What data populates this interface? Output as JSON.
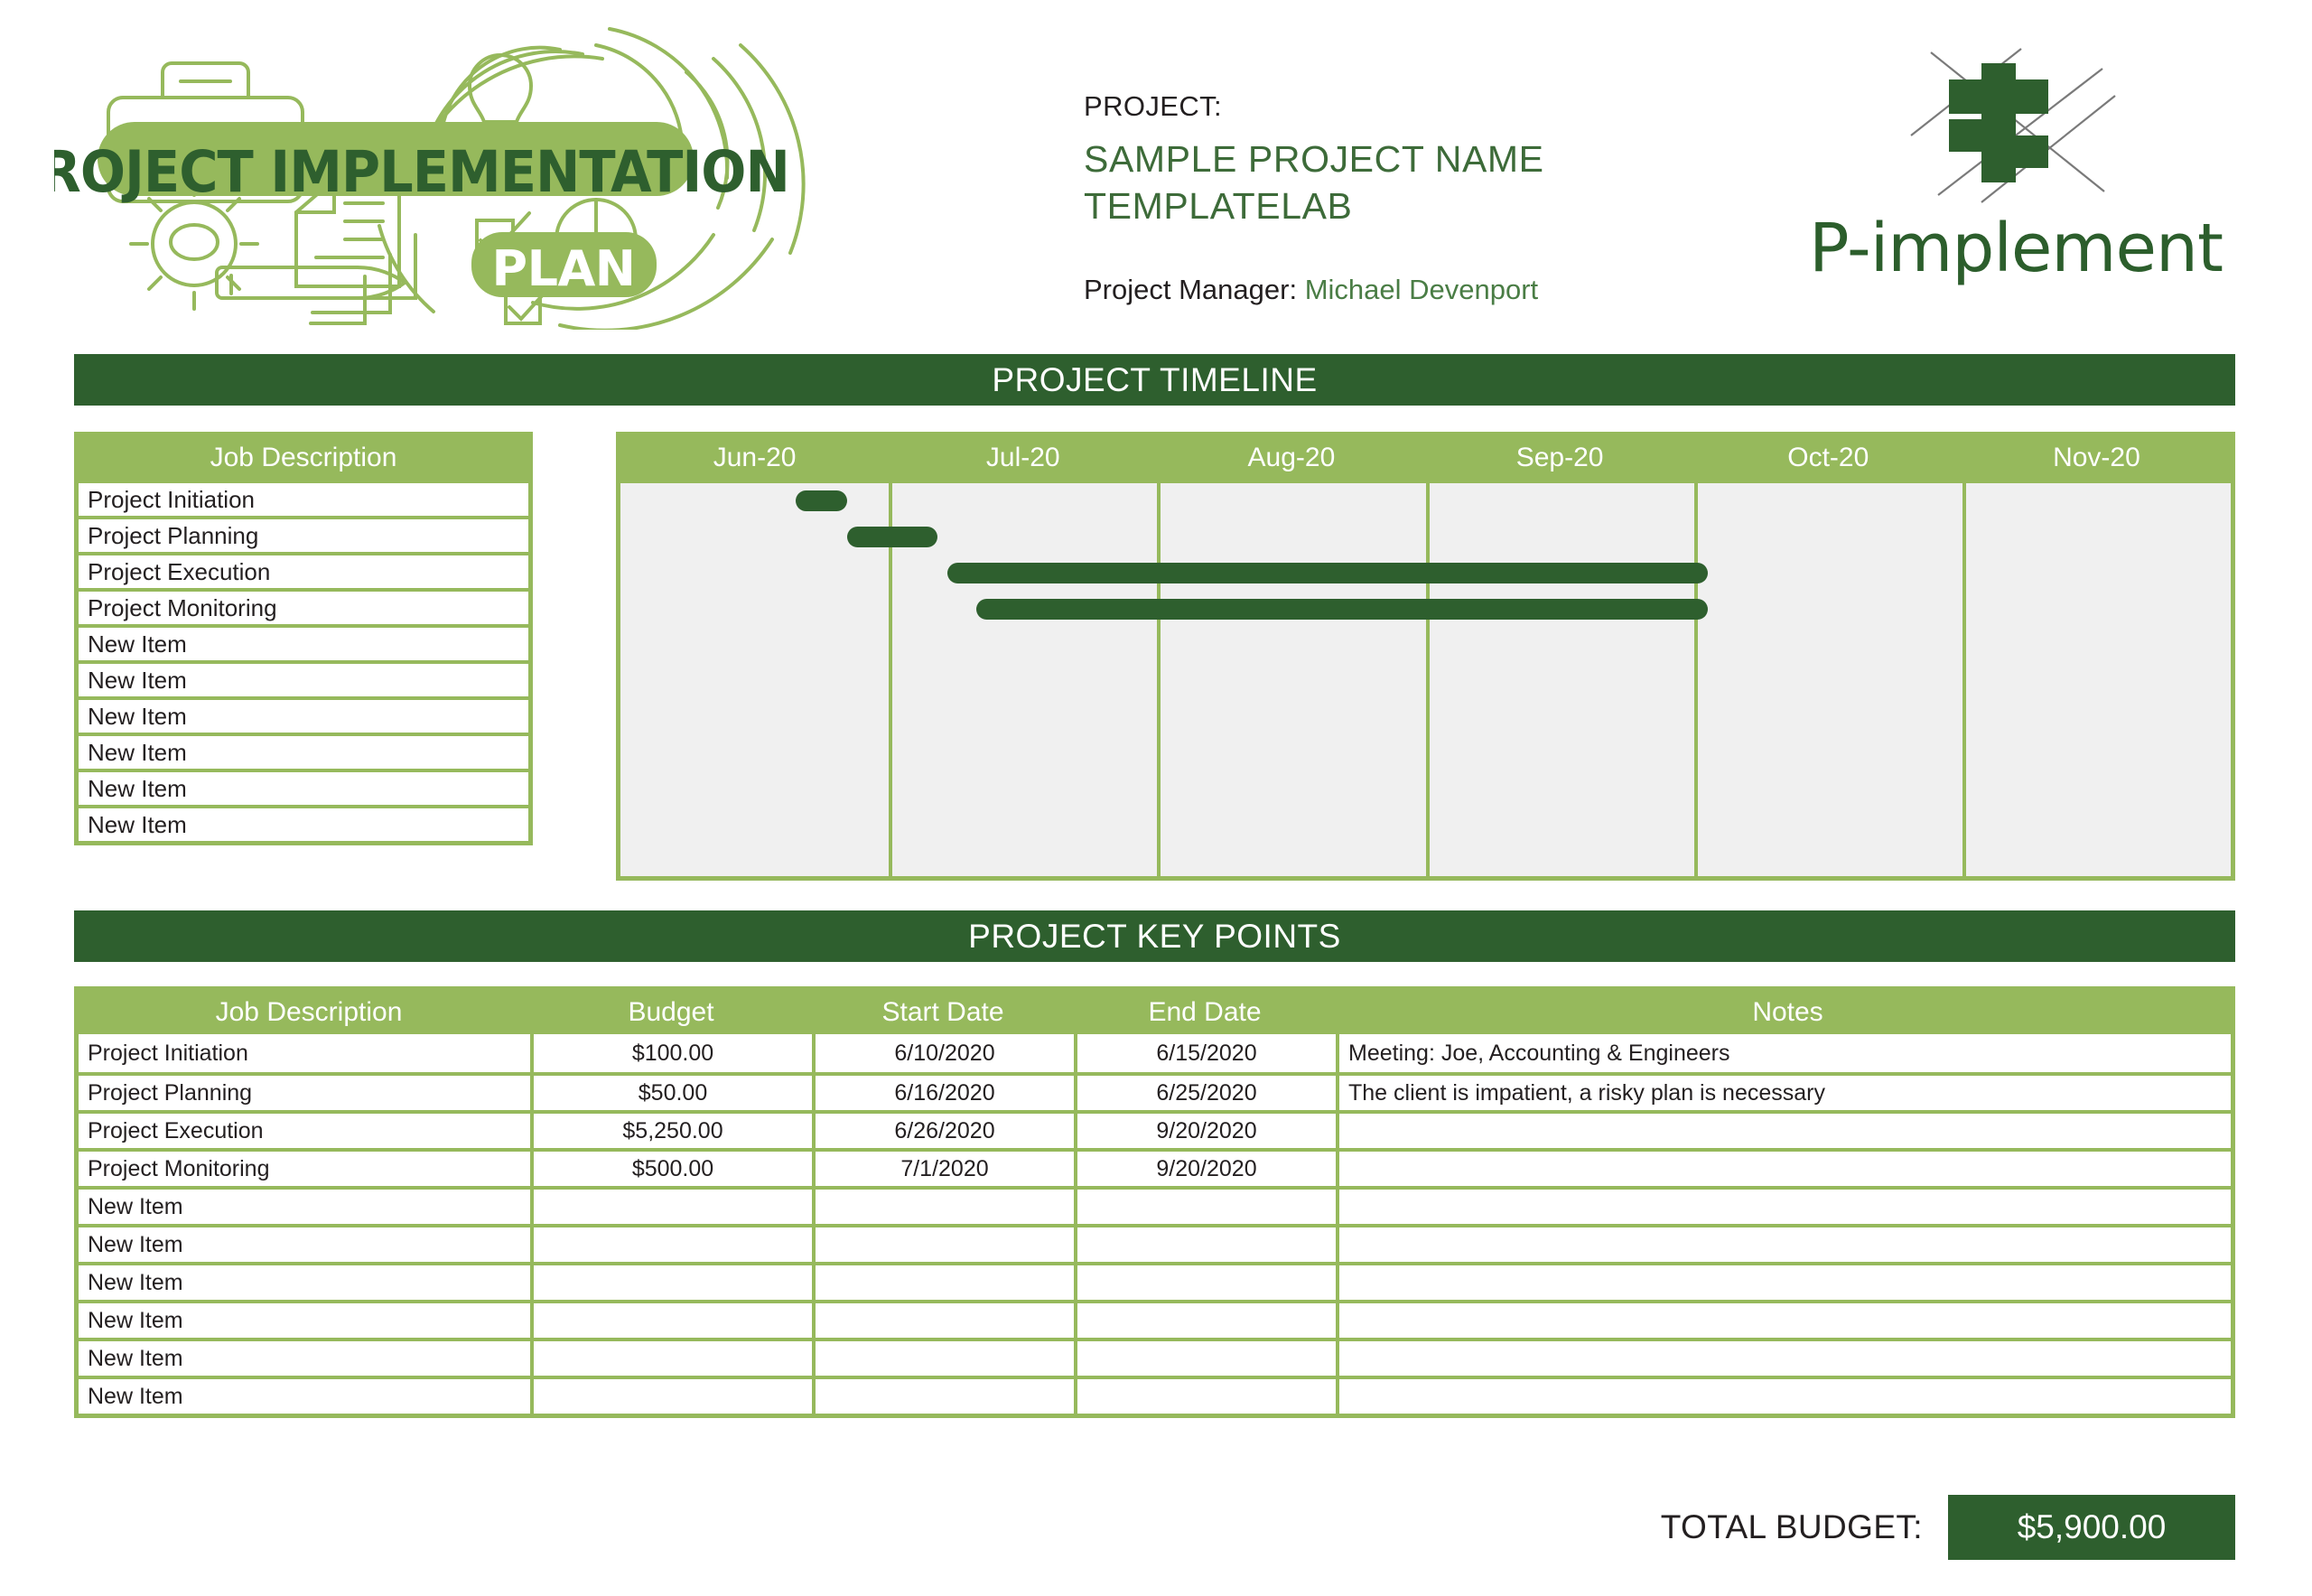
{
  "header": {
    "title_line1": "PROJECT IMPLEMENTATION",
    "title_line2": "PLAN",
    "project_label": "PROJECT:",
    "project_name_line1": "SAMPLE PROJECT NAME",
    "project_name_line2": "TEMPLATELAB",
    "manager_label": "Project Manager:",
    "manager_name": "Michael Devenport",
    "brand_name": "P-implement"
  },
  "colors": {
    "dark_green": "#2e5f2e",
    "light_green": "#96b95c",
    "text_green": "#3d6b39",
    "grid_gray": "#f0f0f0"
  },
  "timeline": {
    "banner": "PROJECT TIMELINE",
    "job_column_header": "Job Description",
    "months": [
      "Jun-20",
      "Jul-20",
      "Aug-20",
      "Sep-20",
      "Oct-20",
      "Nov-20"
    ],
    "rows": [
      "Project Initiation",
      "Project Planning",
      "Project Execution",
      "Project Monitoring",
      "New Item",
      "New Item",
      "New Item",
      "New Item",
      "New Item",
      "New Item"
    ]
  },
  "chart_data": {
    "type": "bar",
    "title": "PROJECT TIMELINE",
    "orientation": "horizontal",
    "categories": [
      "Project Initiation",
      "Project Planning",
      "Project Execution",
      "Project Monitoring",
      "New Item",
      "New Item",
      "New Item",
      "New Item",
      "New Item",
      "New Item"
    ],
    "xlabel": "",
    "ylabel": "",
    "x_ticks": [
      "Jun-20",
      "Jul-20",
      "Aug-20",
      "Sep-20",
      "Oct-20",
      "Nov-20"
    ],
    "grid": true,
    "bars": [
      {
        "row": 0,
        "label": "Project Initiation",
        "start": "6/10/2020",
        "end": "6/15/2020",
        "start_pct": 10.9,
        "end_pct": 14.1
      },
      {
        "row": 1,
        "label": "Project Planning",
        "start": "6/16/2020",
        "end": "6/25/2020",
        "start_pct": 14.1,
        "end_pct": 19.7
      },
      {
        "row": 2,
        "label": "Project Execution",
        "start": "6/26/2020",
        "end": "9/20/2020",
        "start_pct": 20.3,
        "end_pct": 67.5
      },
      {
        "row": 3,
        "label": "Project Monitoring",
        "start": "7/1/2020",
        "end": "9/20/2020",
        "start_pct": 22.1,
        "end_pct": 67.5
      }
    ]
  },
  "keypoints": {
    "banner": "PROJECT KEY POINTS",
    "columns": [
      "Job Description",
      "Budget",
      "Start Date",
      "End Date",
      "Notes"
    ],
    "rows": [
      {
        "job": "Project Initiation",
        "budget": "$100.00",
        "start": "6/10/2020",
        "end": "6/15/2020",
        "notes": "Meeting: Joe, Accounting & Engineers"
      },
      {
        "job": "Project Planning",
        "budget": "$50.00",
        "start": "6/16/2020",
        "end": "6/25/2020",
        "notes": "The client is impatient, a risky plan is necessary"
      },
      {
        "job": "Project Execution",
        "budget": "$5,250.00",
        "start": "6/26/2020",
        "end": "9/20/2020",
        "notes": ""
      },
      {
        "job": "Project Monitoring",
        "budget": "$500.00",
        "start": "7/1/2020",
        "end": "9/20/2020",
        "notes": ""
      },
      {
        "job": "New Item",
        "budget": "",
        "start": "",
        "end": "",
        "notes": ""
      },
      {
        "job": "New Item",
        "budget": "",
        "start": "",
        "end": "",
        "notes": ""
      },
      {
        "job": "New Item",
        "budget": "",
        "start": "",
        "end": "",
        "notes": ""
      },
      {
        "job": "New Item",
        "budget": "",
        "start": "",
        "end": "",
        "notes": ""
      },
      {
        "job": "New Item",
        "budget": "",
        "start": "",
        "end": "",
        "notes": ""
      },
      {
        "job": "New Item",
        "budget": "",
        "start": "",
        "end": "",
        "notes": ""
      }
    ]
  },
  "footer": {
    "total_label": "TOTAL BUDGET:",
    "total_value": "$5,900.00"
  }
}
